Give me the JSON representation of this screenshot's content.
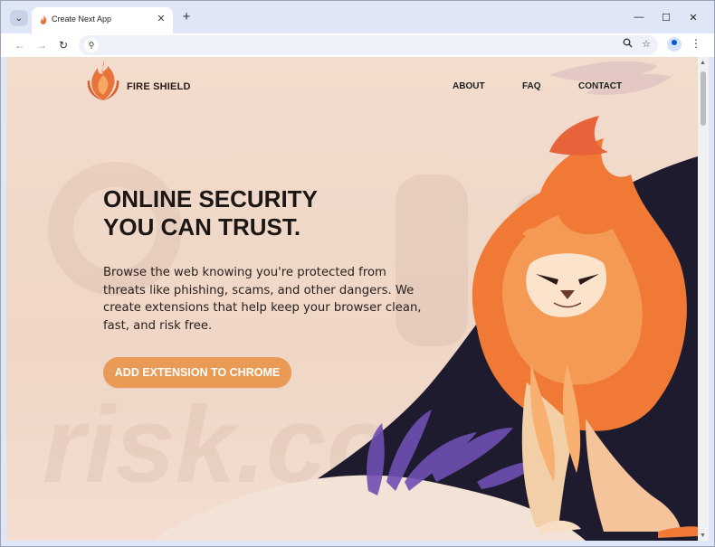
{
  "browser": {
    "tab_title": "Create Next App",
    "tab_close": "✕",
    "new_tab": "+",
    "tab_menu": "⌄",
    "controls": {
      "minimize": "—",
      "maximize": "☐",
      "close": "✕"
    },
    "nav": {
      "back": "←",
      "forward": "→",
      "reload": "↻"
    },
    "site_info_icon": "⚲",
    "zoom_icon": "🔍",
    "bookmark_icon": "☆",
    "menu_icon": "⋮"
  },
  "site": {
    "brand": "FIRE SHIELD",
    "nav": [
      {
        "label": "ABOUT"
      },
      {
        "label": "FAQ"
      },
      {
        "label": "CONTACT"
      }
    ],
    "hero": {
      "title_line1": "ONLINE SECURITY",
      "title_line2": "YOU CAN TRUST.",
      "body": "Browse the web knowing you're protected from threats like phishing, scams, and other dangers. We create extensions that help keep your browser clean, fast, and risk free.",
      "cta": "ADD EXTENSION TO CHROME"
    },
    "watermark": "risk.com"
  },
  "colors": {
    "accent": "#e99a55",
    "flame": "#f07a35",
    "dark_wave": "#1f1b2e",
    "background": "#f2dccd"
  }
}
